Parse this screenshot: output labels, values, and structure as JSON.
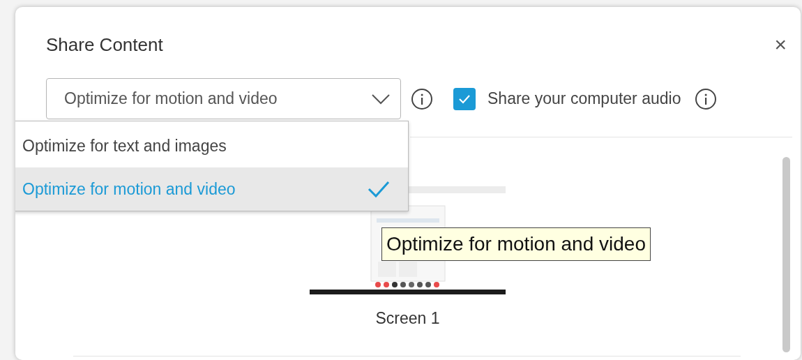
{
  "dialog": {
    "title": "Share Content",
    "close": "×"
  },
  "optimize_select": {
    "value": "Optimize for motion and video",
    "expanded": true,
    "options": [
      {
        "label": "Optimize for text and images",
        "selected": false
      },
      {
        "label": "Optimize for motion and video",
        "selected": true
      }
    ]
  },
  "share_audio": {
    "label": "Share your computer audio",
    "checked": true
  },
  "screens": [
    {
      "label": "Screen 1",
      "kind": "picture"
    }
  ],
  "tooltip": {
    "text": "Optimize for motion and video"
  }
}
